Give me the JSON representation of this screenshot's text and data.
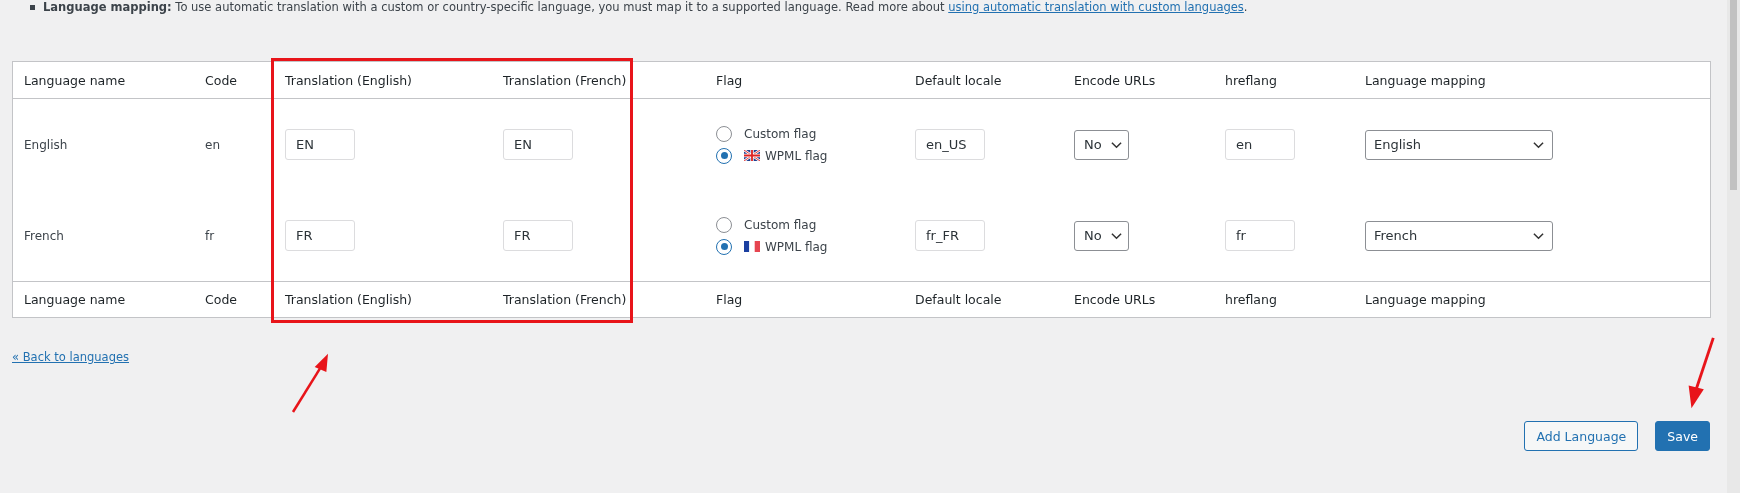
{
  "notice": {
    "text": "**Language mapping:** To use automatic translation with a custom or country-specific language, you must map it to a supported language. Read more about",
    "link": "using automatic translation with custom languages",
    "tail": "."
  },
  "table": {
    "columns": [
      "Language name",
      "Code",
      "Translation (English)",
      "Translation (French)",
      "Flag",
      "Default locale",
      "Encode URLs",
      "hreflang",
      "Language mapping"
    ],
    "rows": [
      {
        "name": "English",
        "code": "en",
        "translations": [
          "EN",
          "EN"
        ],
        "flag_options": [
          {
            "label": "Custom flag",
            "selected": false
          },
          {
            "label": "WPML flag",
            "selected": true
          }
        ],
        "default_locale": "en_US",
        "encode_urls": "No",
        "hreflang": "en",
        "mapping": "English"
      },
      {
        "name": "French",
        "code": "fr",
        "translations": [
          "FR",
          "FR"
        ],
        "flag_options": [
          {
            "label": "Custom flag",
            "selected": false
          },
          {
            "label": "WPML flag",
            "selected": true
          }
        ],
        "default_locale": "fr_FR",
        "encode_urls": "No",
        "hreflang": "fr",
        "mapping": "French"
      }
    ],
    "footer_columns": [
      "Language name",
      "Code",
      "Translation (English)",
      "Translation (French)",
      "Flag",
      "Default locale",
      "Encode URLs",
      "hreflang",
      "Language mapping"
    ]
  },
  "back_link": "« Back to languages",
  "buttons": [
    {
      "label": "Add Language",
      "kind": "secondary"
    },
    {
      "label": "Save",
      "kind": "primary"
    }
  ]
}
